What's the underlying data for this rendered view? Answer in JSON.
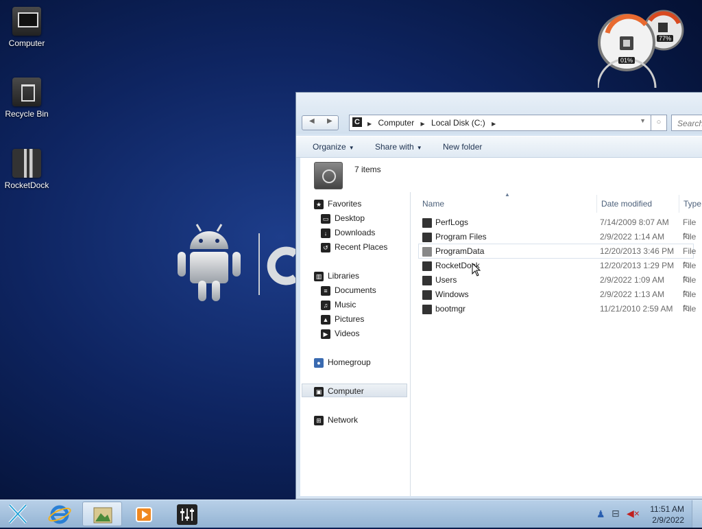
{
  "desktop": {
    "icons": [
      {
        "label": "Computer",
        "icon": "computer-icon"
      },
      {
        "label": "Recycle Bin",
        "icon": "recycle-bin-icon"
      },
      {
        "label": "RocketDock",
        "icon": "rocketdock-icon"
      }
    ],
    "gauges": {
      "cpu": "01%",
      "memory": "77%"
    }
  },
  "explorer": {
    "address": {
      "crumbs": [
        "Computer",
        "Local Disk (C:)"
      ],
      "drive_letter": "C"
    },
    "search_placeholder": "Search",
    "toolbar": {
      "organize": "Organize",
      "share_with": "Share with",
      "new_folder": "New folder"
    },
    "item_count": "7 items",
    "nav": {
      "favorites": "Favorites",
      "favorites_items": [
        "Desktop",
        "Downloads",
        "Recent Places"
      ],
      "libraries": "Libraries",
      "libraries_items": [
        "Documents",
        "Music",
        "Pictures",
        "Videos"
      ],
      "homegroup": "Homegroup",
      "computer": "Computer",
      "network": "Network"
    },
    "columns": {
      "name": "Name",
      "date": "Date modified",
      "type": "Type"
    },
    "files": [
      {
        "name": "PerfLogs",
        "date": "7/14/2009 8:07 AM",
        "type": "File fo"
      },
      {
        "name": "Program Files",
        "date": "2/9/2022 1:14 AM",
        "type": "File fo"
      },
      {
        "name": "ProgramData",
        "date": "12/20/2013 3:46 PM",
        "type": "File fo"
      },
      {
        "name": "RocketDock",
        "date": "12/20/2013 1:29 PM",
        "type": "File fo"
      },
      {
        "name": "Users",
        "date": "2/9/2022 1:09 AM",
        "type": "File fo"
      },
      {
        "name": "Windows",
        "date": "2/9/2022 1:13 AM",
        "type": "File fo"
      },
      {
        "name": "bootmgr",
        "date": "11/21/2010 2:59 AM",
        "type": "File"
      }
    ]
  },
  "taskbar": {
    "clock_time": "11:51 AM",
    "clock_date": "2/9/2022"
  }
}
